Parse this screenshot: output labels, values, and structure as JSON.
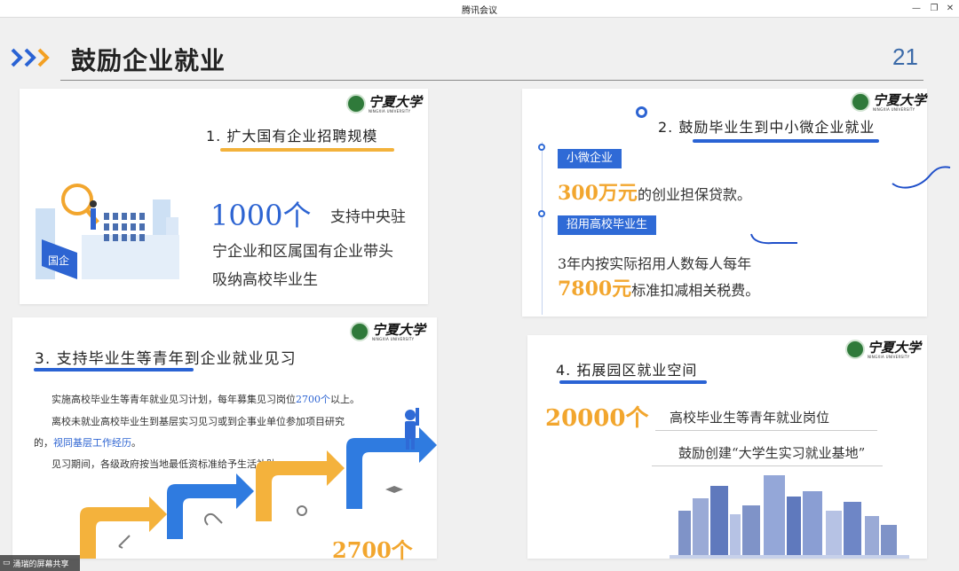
{
  "window": {
    "title": "腾讯会议"
  },
  "slide": {
    "title": "鼓励企业就业",
    "page_number": "21",
    "logo": {
      "cn": "宁夏大学",
      "en": "NINGXIA UNIVERSITY"
    }
  },
  "card1": {
    "heading": "1. 扩大国有企业招聘规模",
    "big_number": "1000个",
    "line1": "支持中央驻",
    "line2": "宁企业和区属国有企业带头",
    "line3": "吸纳高校毕业生",
    "illustration_label": "国企"
  },
  "card2": {
    "heading": "2. 鼓励毕业生到中小微企业就业",
    "tag1": "小微企业",
    "amount1": "300万元",
    "text1": "的创业担保贷款。",
    "tag2": "招用高校毕业生",
    "text2": "3年内按实际招用人数每人每年",
    "amount2": "7800元",
    "text3": "标准扣减相关税费。"
  },
  "card3": {
    "heading": "3. 支持毕业生等青年到企业就业见习",
    "p1_a": "实施高校毕业生等青年就业见习计划，每年募集见习岗位",
    "p1_hl": "2700个",
    "p1_b": "以上。",
    "p2": "离校未就业高校毕业生到基层实习见习或到企事业单位参加项目研究",
    "p3_a": "的，",
    "p3_hl": "视同基层工作经历",
    "p3_b": "。",
    "p4": "见习期间，各级政府按当地最低资标准给予生活补贴。",
    "big_number": "2700个"
  },
  "card4": {
    "heading": "4. 拓展园区就业空间",
    "big_number": "20000个",
    "text1": "高校毕业生等青年就业岗位",
    "text2": "鼓励创建“大学生实习就业基地”"
  },
  "bottom": {
    "share_label": "涌瑞的屏幕共享"
  },
  "colors": {
    "accent_blue": "#2d64d2",
    "accent_orange": "#f2a62e",
    "chevron_blue": "#2a63d4",
    "chevron_orange": "#f3a023"
  }
}
